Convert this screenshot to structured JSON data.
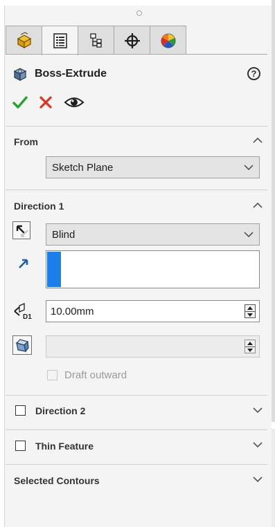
{
  "panel": {
    "title": "Boss-Extrude",
    "help_label": "?"
  },
  "tabs": [
    {
      "name": "featuremanager-icon",
      "active": false
    },
    {
      "name": "propertymanager-icon",
      "active": true
    },
    {
      "name": "configurationmanager-icon",
      "active": false
    },
    {
      "name": "dimxpertmanager-icon",
      "active": false
    },
    {
      "name": "displaymanager-icon",
      "active": false
    }
  ],
  "actions": {
    "ok_icon": "checkmark-icon",
    "cancel_icon": "close-icon",
    "preview_icon": "eye-icon"
  },
  "from": {
    "title": "From",
    "value": "Sketch Plane"
  },
  "direction1": {
    "title": "Direction 1",
    "end_condition": "Blind",
    "depth": "10.00mm",
    "draft_value": "",
    "draft_outward_label": "Draft outward"
  },
  "direction2": {
    "title": "Direction 2"
  },
  "thin_feature": {
    "title": "Thin Feature"
  },
  "selected_contours": {
    "title": "Selected Contours"
  },
  "colors": {
    "accent": "#1a7fe8",
    "ok": "#27a22a",
    "cancel": "#e03020"
  }
}
